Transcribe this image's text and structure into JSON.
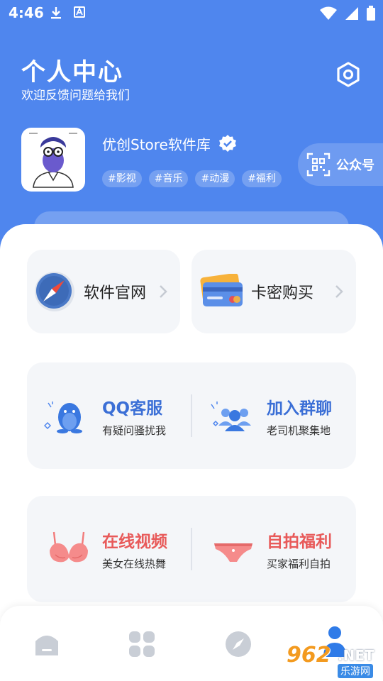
{
  "status_bar": {
    "time": "4:46",
    "left_icons": [
      "download-icon",
      "notification-icon"
    ],
    "right_icons": [
      "wifi-icon",
      "signal-icon",
      "battery-icon"
    ]
  },
  "header": {
    "title": "个人中心",
    "subtitle": "欢迎反馈问题给我们",
    "settings_icon": "hexagon-settings-icon"
  },
  "profile": {
    "name": "优创Store软件库",
    "verified_icon": "verified-badge-icon",
    "tags": [
      "#影视",
      "#音乐",
      "#动漫",
      "#福利"
    ],
    "official_account_label": "公众号",
    "official_account_icon": "qr-code-icon"
  },
  "quick_links": [
    {
      "label": "软件官网",
      "icon": "compass-safari-icon"
    },
    {
      "label": "卡密购买",
      "icon": "credit-card-icon"
    }
  ],
  "services": [
    {
      "title": "QQ客服",
      "subtitle": "有疑问骚扰我",
      "color": "#3b6fd6",
      "icon": "qq-penguin-icon"
    },
    {
      "title": "加入群聊",
      "subtitle": "老司机聚集地",
      "color": "#3b6fd6",
      "icon": "group-chat-icon"
    }
  ],
  "welfare": [
    {
      "title": "在线视频",
      "subtitle": "美女在线热舞",
      "color": "#e85a5a",
      "icon": "bra-icon"
    },
    {
      "title": "自拍福利",
      "subtitle": "买家福利自拍",
      "color": "#e85a5a",
      "icon": "underwear-icon"
    }
  ],
  "bottom_nav": [
    {
      "name": "home",
      "icon": "home-icon"
    },
    {
      "name": "apps",
      "icon": "grid-icon"
    },
    {
      "name": "discover",
      "icon": "compass-icon"
    },
    {
      "name": "profile",
      "icon": "person-icon"
    }
  ],
  "watermark": {
    "number": "962",
    "domain": ".NET",
    "text": "乐游网"
  },
  "colors": {
    "primary": "#4f86ee",
    "card_bg": "#f4f6f9",
    "blue_text": "#3b6fd6",
    "red_text": "#e85a5a"
  }
}
